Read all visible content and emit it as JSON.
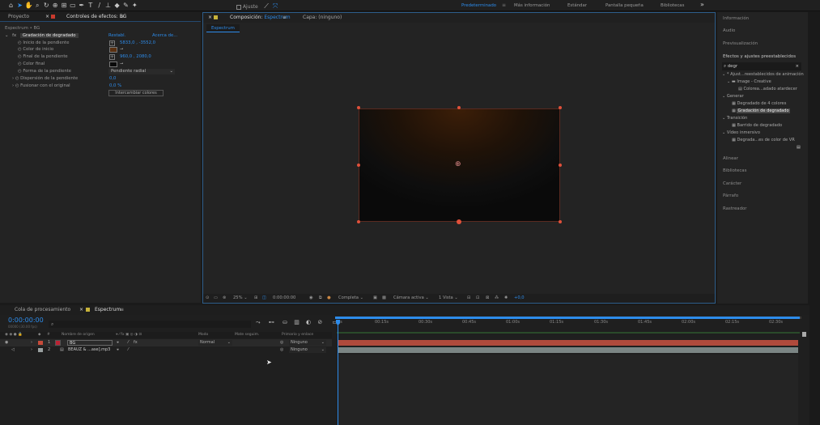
{
  "toolbar": {
    "snap_label": "Ajuste",
    "workspaces": [
      "Predeterminado",
      "Más información",
      "Estándar",
      "Pantalla pequeña",
      "Bibliotecas"
    ],
    "more": "»"
  },
  "left_panel": {
    "tab_project": "Proyecto",
    "tab_effects": "Controles de efectos: BG",
    "layer_path": "Espectrum • BG",
    "effect_name": "Gradación de degradado",
    "reset": "Restabl.",
    "about": "Acerca de...",
    "props": [
      {
        "label": "Inicio de la pendiente",
        "value": "5833,0 , -3552,0"
      },
      {
        "label": "Color de inicio",
        "value": ""
      },
      {
        "label": "Final de la pendiente",
        "value": "960,0 , 2080,0"
      },
      {
        "label": "Color final",
        "value": ""
      },
      {
        "label": "Forma de la pendiente",
        "value": "Pendiente radial"
      },
      {
        "label": "Dispersión de la pendiente",
        "value": "0,0"
      },
      {
        "label": "Fusionar con el original",
        "value": "0,0 %"
      }
    ],
    "swap_button": "Intercambiar colores"
  },
  "comp": {
    "tab": "Composición: Espectrum",
    "tab_prefix": "Composición",
    "tab_name": "Espectrum",
    "layer_tab": "Capa: (ninguno)",
    "crumb": "Espectrum",
    "footer": {
      "zoom": "25%",
      "time": "0:00:00:00",
      "quality": "Completa",
      "camera": "Cámara activa",
      "view": "1 Vista",
      "exposure": "+0,0"
    }
  },
  "right_panel": {
    "items_top": [
      "Información",
      "Audio",
      "Previsualización"
    ],
    "effects_title": "Efectos y ajustes preestablecidos",
    "search_value": "degr",
    "tree": [
      {
        "label": "* Ajust...reestablecidos de animación",
        "indent": 0
      },
      {
        "label": "Image - Creative",
        "indent": 1
      },
      {
        "label": "Colorea...adado atardecer",
        "indent": 2
      },
      {
        "label": "Generar",
        "indent": 0
      },
      {
        "label": "Degradado de 4 colores",
        "indent": 1
      },
      {
        "label": "Gradación de degradado",
        "indent": 1,
        "selected": true
      },
      {
        "label": "Transición",
        "indent": 0
      },
      {
        "label": "Barrido de degradado",
        "indent": 1
      },
      {
        "label": "Vídeo inmersivo",
        "indent": 0
      },
      {
        "label": "Degrada...es de color de VR",
        "indent": 1
      }
    ],
    "items_bottom": [
      "Alinear",
      "Bibliotecas",
      "Carácter",
      "Párrafo",
      "Rastreador"
    ]
  },
  "timeline": {
    "tab_queue": "Cola de procesamiento",
    "tab_comp": "Espectrum",
    "timecode": "0:00:00:00",
    "fps": "00000 (30.00 fps)",
    "columns": {
      "name": "Nombre de origen",
      "mode": "Modo",
      "trkmat": "Mate seguim.",
      "parent": "Primario y enlace"
    },
    "layers": [
      {
        "num": "1",
        "name": "BG",
        "mode": "Normal",
        "parent": "Ninguno",
        "color": "#c84b3a"
      },
      {
        "num": "2",
        "name": "BEAUZ & ...ase].mp3",
        "mode": "",
        "parent": "Ninguno",
        "color": "#9aa0a0"
      }
    ],
    "ticks": [
      "0s",
      "00:15s",
      "00:30s",
      "00:45s",
      "01:00s",
      "01:15s",
      "01:30s",
      "01:45s",
      "02:00s",
      "02:15s",
      "02:30s"
    ]
  }
}
